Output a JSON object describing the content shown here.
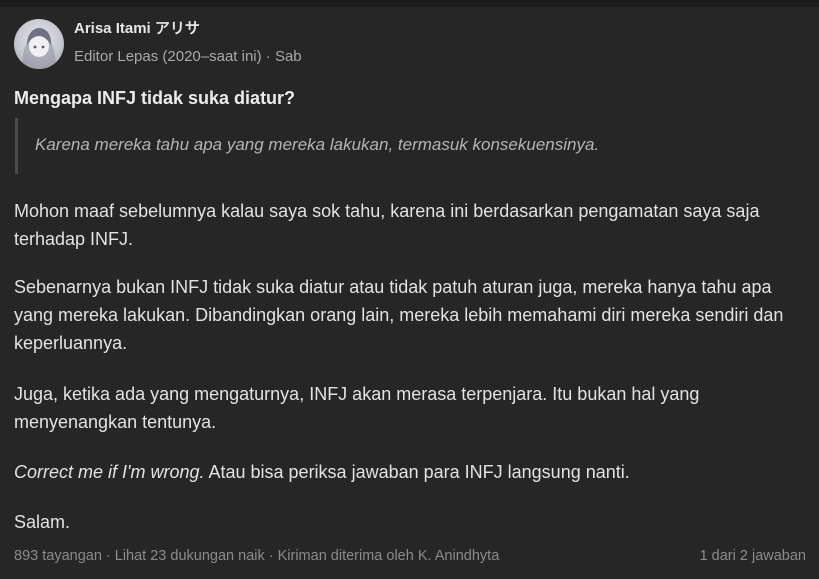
{
  "author": {
    "name": "Arisa Itami アリサ",
    "credential": "Editor Lepas (2020–saat ini) · Sab"
  },
  "question": "Mengapa INFJ tidak suka diatur?",
  "quote": "Karena mereka tahu apa yang mereka lakukan, termasuk konsekuensinya.",
  "paragraphs": {
    "p1": "Mohon maaf sebelumnya kalau saya sok tahu, karena ini berdasarkan pengamatan saya saja terhadap INFJ.",
    "p2": "Sebenarnya bukan INFJ tidak suka diatur atau tidak patuh aturan juga, mereka hanya tahu apa yang mereka lakukan. Dibandingkan orang lain, mereka lebih memahami diri mereka sendiri dan keperluannya.",
    "p3": "Juga, ketika ada yang mengaturnya, INFJ akan merasa terpenjara. Itu bukan hal yang menyenangkan tentunya.",
    "p4_italic": "Correct me if I'm wrong.",
    "p4_rest": " Atau bisa periksa jawaban para INFJ langsung nanti.",
    "p5": "Salam."
  },
  "footer": {
    "stats": "893 tayangan · Lihat 23 dukungan naik · Kiriman diterima oleh K. Anindhyta",
    "pager": "1 dari 2 jawaban"
  }
}
